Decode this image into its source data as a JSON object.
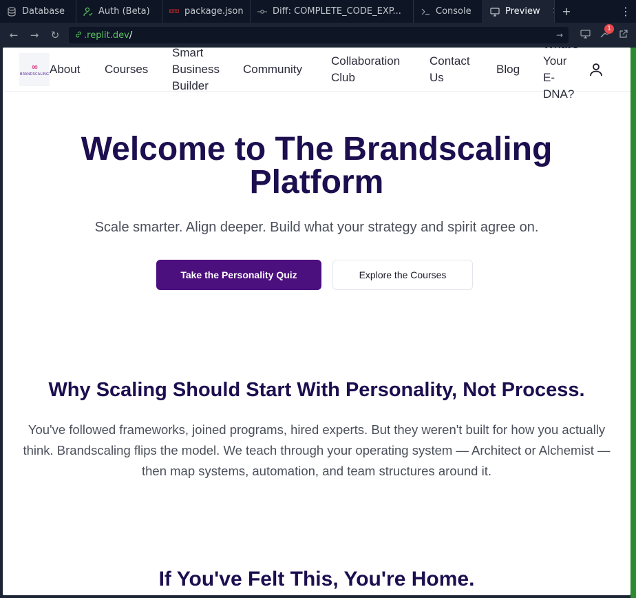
{
  "tabs": [
    {
      "label": "Database",
      "icon": "database-icon"
    },
    {
      "label": "Auth (Beta)",
      "icon": "user-check-icon"
    },
    {
      "label": "package.json",
      "icon": "npm-icon"
    },
    {
      "label": "Diff: COMPLETE_CODE_EXP...",
      "icon": "git-commit-icon"
    },
    {
      "label": "Console",
      "icon": "terminal-icon"
    },
    {
      "label": "Preview",
      "icon": "monitor-icon",
      "active": true
    }
  ],
  "address": {
    "host": ".replit.dev",
    "path": "/"
  },
  "notification_count": "1",
  "site": {
    "logo_mark": "∞",
    "logo_text": "BRANDSCALING",
    "nav": {
      "about": "About",
      "courses": "Courses",
      "smart_business_builder": "Smart Business Builder",
      "community": "Community",
      "collaboration_club": "Collaboration Club",
      "contact_us": "Contact Us",
      "blog": "Blog",
      "whats_your_edna": "What's Your E-DNA?"
    }
  },
  "hero": {
    "title": "Welcome to The Brandscaling Platform",
    "subtitle": "Scale smarter. Align deeper. Build what your strategy and spirit agree on.",
    "primary_cta": "Take the Personality Quiz",
    "secondary_cta": "Explore the Courses"
  },
  "why": {
    "title": "Why Scaling Should Start With Personality, Not Process.",
    "body": "You've followed frameworks, joined programs, hired experts. But they weren't built for how you actually think. Brandscaling flips the model. We teach through your operating system — Architect or Alchemist — then map systems, automation, and team structures around it."
  },
  "felt": {
    "title": "If You've Felt This, You're Home."
  },
  "colors": {
    "ide_bg": "#0e1525",
    "brand_navy": "#1c0e4f",
    "brand_purple": "#4b0f7e",
    "url_green": "#5bc060"
  }
}
